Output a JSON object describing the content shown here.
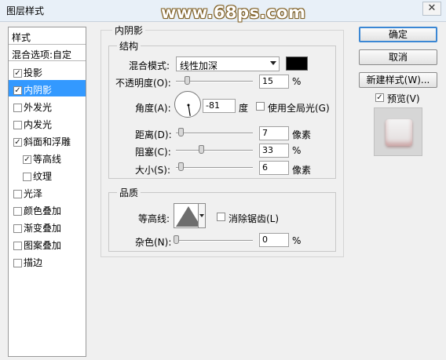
{
  "window": {
    "title": "图层样式",
    "close_glyph": "✕",
    "watermark": "www.68ps.com"
  },
  "sidebar": {
    "header": "样式",
    "blend_options": "混合选项:自定",
    "items": [
      {
        "label": "投影",
        "checked": true
      },
      {
        "label": "内阴影",
        "checked": true,
        "selected": true
      },
      {
        "label": "外发光",
        "checked": false
      },
      {
        "label": "内发光",
        "checked": false
      },
      {
        "label": "斜面和浮雕",
        "checked": true
      },
      {
        "label": "等高线",
        "checked": true,
        "sub": true
      },
      {
        "label": "纹理",
        "checked": false,
        "sub": true
      },
      {
        "label": "光泽",
        "checked": false
      },
      {
        "label": "颜色叠加",
        "checked": false
      },
      {
        "label": "渐变叠加",
        "checked": false
      },
      {
        "label": "图案叠加",
        "checked": false
      },
      {
        "label": "描边",
        "checked": false
      }
    ]
  },
  "panel": {
    "title": "内阴影",
    "structure": {
      "legend": "结构",
      "blend_mode_label": "混合模式:",
      "blend_mode_value": "线性加深",
      "shadow_color": "#000000",
      "opacity_label": "不透明度(O):",
      "opacity_value": "15",
      "opacity_unit": "%",
      "opacity_level": 0.15,
      "angle_label": "角度(A):",
      "angle_value": "-81",
      "angle_unit": "度",
      "global_light_label": "使用全局光(G)",
      "global_light_checked": false,
      "distance_label": "距离(D):",
      "distance_value": "7",
      "distance_unit": "像素",
      "choke_label": "阻塞(C):",
      "choke_value": "33",
      "choke_unit": "%",
      "size_label": "大小(S):",
      "size_value": "6",
      "size_unit": "像素"
    },
    "quality": {
      "legend": "品质",
      "contour_label": "等高线:",
      "anti_alias_label": "消除锯齿(L)",
      "anti_alias_checked": false,
      "noise_label": "杂色(N):",
      "noise_value": "0",
      "noise_unit": "%"
    }
  },
  "buttons": {
    "ok": "确定",
    "cancel": "取消",
    "new_style": "新建样式(W)..."
  },
  "preview": {
    "label": "预览(V)",
    "checked": true
  },
  "accent_color": "#3399ff"
}
